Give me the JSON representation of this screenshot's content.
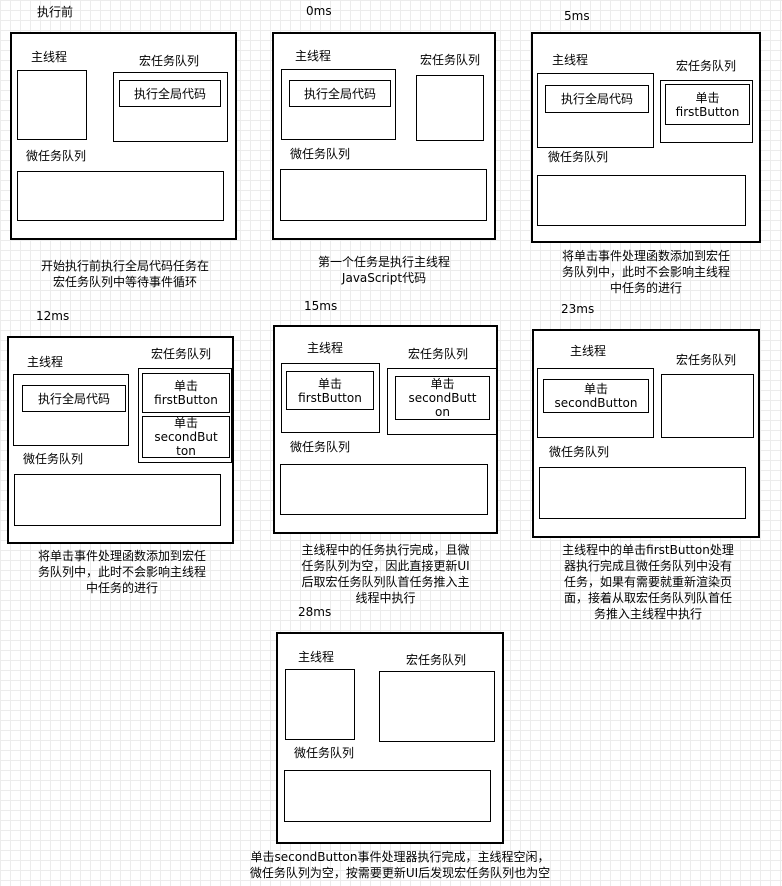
{
  "labels": {
    "main_thread": "主线程",
    "macro_queue": "宏任务队列",
    "micro_queue": "微任务队列"
  },
  "tasks": {
    "global_code": "执行全局代码",
    "click_first": "单击\nfirstButton",
    "click_second": "单击\nsecondButton",
    "click_second_wrapped": "单击\nsecondButt\non",
    "click_second_clipped": "单击\nsecondBut\nton"
  },
  "frames": [
    {
      "time": "执行前",
      "caption": "开始执行前执行全局代码任务在\n宏任务队列中等待事件循环"
    },
    {
      "time": "0ms",
      "caption": "第一个任务是执行主线程\nJavaScript代码"
    },
    {
      "time": "5ms",
      "caption": "将单击事件处理函数添加到宏任\n务队列中，此时不会影响主线程\n中任务的进行"
    },
    {
      "time": "12ms",
      "caption": "将单击事件处理函数添加到宏任\n务队列中，此时不会影响主线程\n中任务的进行"
    },
    {
      "time": "15ms",
      "caption": "主线程中的任务执行完成，且微\n任务队列为空，因此直接更新UI\n后取宏任务队列队首任务推入主\n线程中执行"
    },
    {
      "time": "23ms",
      "caption": "主线程中的单击firstButton处理\n器执行完成且微任务队列中没有\n任务，如果有需要就重新渲染页\n面，接着从取宏任务队列队首任\n务推入主线程中执行"
    },
    {
      "time": "28ms",
      "caption": "单击secondButton事件处理器执行完成，主线程空闲，\n微任务队列为空，按需要更新UI后发现宏任务队列也为空"
    }
  ]
}
